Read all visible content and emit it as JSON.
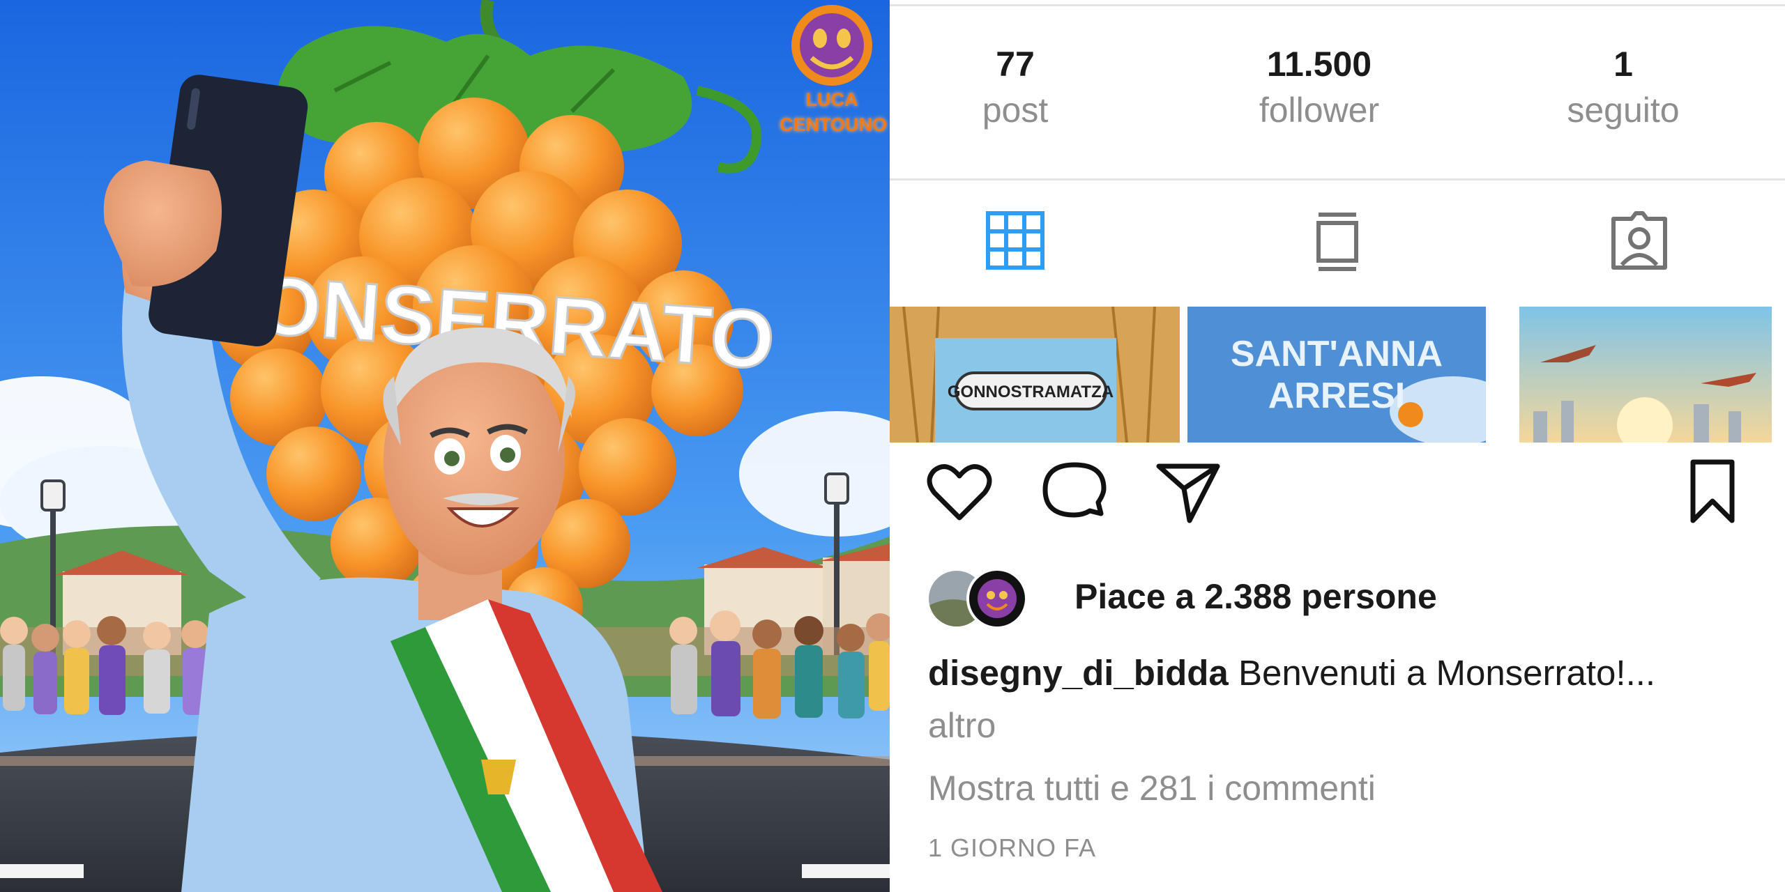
{
  "artwork": {
    "headline": "MONSERRATO",
    "signature_line1": "LUCA",
    "signature_line2": "CENTOUNO"
  },
  "profile": {
    "stats": [
      {
        "value": "77",
        "label": "post"
      },
      {
        "value": "11.500",
        "label": "follower"
      },
      {
        "value": "1",
        "label": "seguito"
      }
    ]
  },
  "tabs": [
    {
      "icon": "grid-icon",
      "active": true
    },
    {
      "icon": "reels-icon",
      "active": false
    },
    {
      "icon": "tagged-icon",
      "active": false
    }
  ],
  "thumbnails": [
    {
      "sign": "GONNOSTRAMATZA"
    },
    {
      "title_line1": "SANT'ANNA",
      "title_line2": "ARRESI"
    },
    {
      "caption": "airplanes-over-city"
    }
  ],
  "actions": [
    "heart-icon",
    "comment-icon",
    "share-icon",
    "bookmark-icon"
  ],
  "post": {
    "likes_text": "Piace a 2.388 persone",
    "username": "disegny_di_bidda",
    "caption": "Benvenuti a Monserrato!...",
    "more_label": "altro",
    "comments_link": "Mostra tutti e 281 i commenti",
    "time_ago": "1 GIORNO FA"
  },
  "colors": {
    "accent_blue": "#2f9df4",
    "icon_gray": "#737373",
    "text_dark": "#1a1a1a",
    "text_muted": "#8e8e8e",
    "orange": "#f7962b"
  }
}
